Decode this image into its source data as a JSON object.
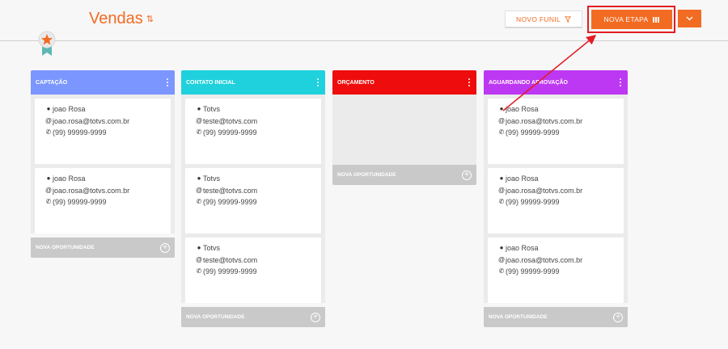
{
  "header": {
    "title": "Vendas"
  },
  "toolbar": {
    "novo_funil_label": "NOVO FUNIL",
    "nova_etapa_label": "NOVA ETAPA"
  },
  "colors": {
    "accent": "#f26b22",
    "annotation": "#e31c23"
  },
  "columns": [
    {
      "title": "CAPTAÇÃO",
      "color": "#7b96ff",
      "cards": [
        {
          "name": "joao Rosa",
          "email": "joao.rosa@totvs.com.br",
          "phone": "(99) 99999-9999"
        },
        {
          "name": "joao Rosa",
          "email": "joao.rosa@totvs.com.br",
          "phone": "(99) 99999-9999"
        }
      ],
      "footer": "NOVA OPORTUNIDADE"
    },
    {
      "title": "CONTATO INICIAL",
      "color": "#1fd1dc",
      "cards": [
        {
          "name": "Totvs",
          "email": "teste@totvs.com",
          "phone": "(99) 99999-9999"
        },
        {
          "name": "Totvs",
          "email": "teste@totvs.com",
          "phone": "(99) 99999-9999"
        },
        {
          "name": "Totvs",
          "email": "teste@totvs.com",
          "phone": "(99) 99999-9999"
        }
      ],
      "footer": "NOVA OPORTUNIDADE"
    },
    {
      "title": "ORÇAMENTO",
      "color": "#ee0c0c",
      "cards": [],
      "footer": "NOVA OPORTUNIDADE"
    },
    {
      "title": "AGUARDANDO APROVAÇÃO",
      "color": "#bd38f2",
      "cards": [
        {
          "name": "joao Rosa",
          "email": "joao.rosa@totvs.com.br",
          "phone": "(99) 99999-9999"
        },
        {
          "name": "joao Rosa",
          "email": "joao.rosa@totvs.com.br",
          "phone": "(99) 99999-9999"
        },
        {
          "name": "joao Rosa",
          "email": "joao.rosa@totvs.com.br",
          "phone": "(99) 99999-9999"
        }
      ],
      "footer": "NOVA OPORTUNIDADE"
    }
  ]
}
